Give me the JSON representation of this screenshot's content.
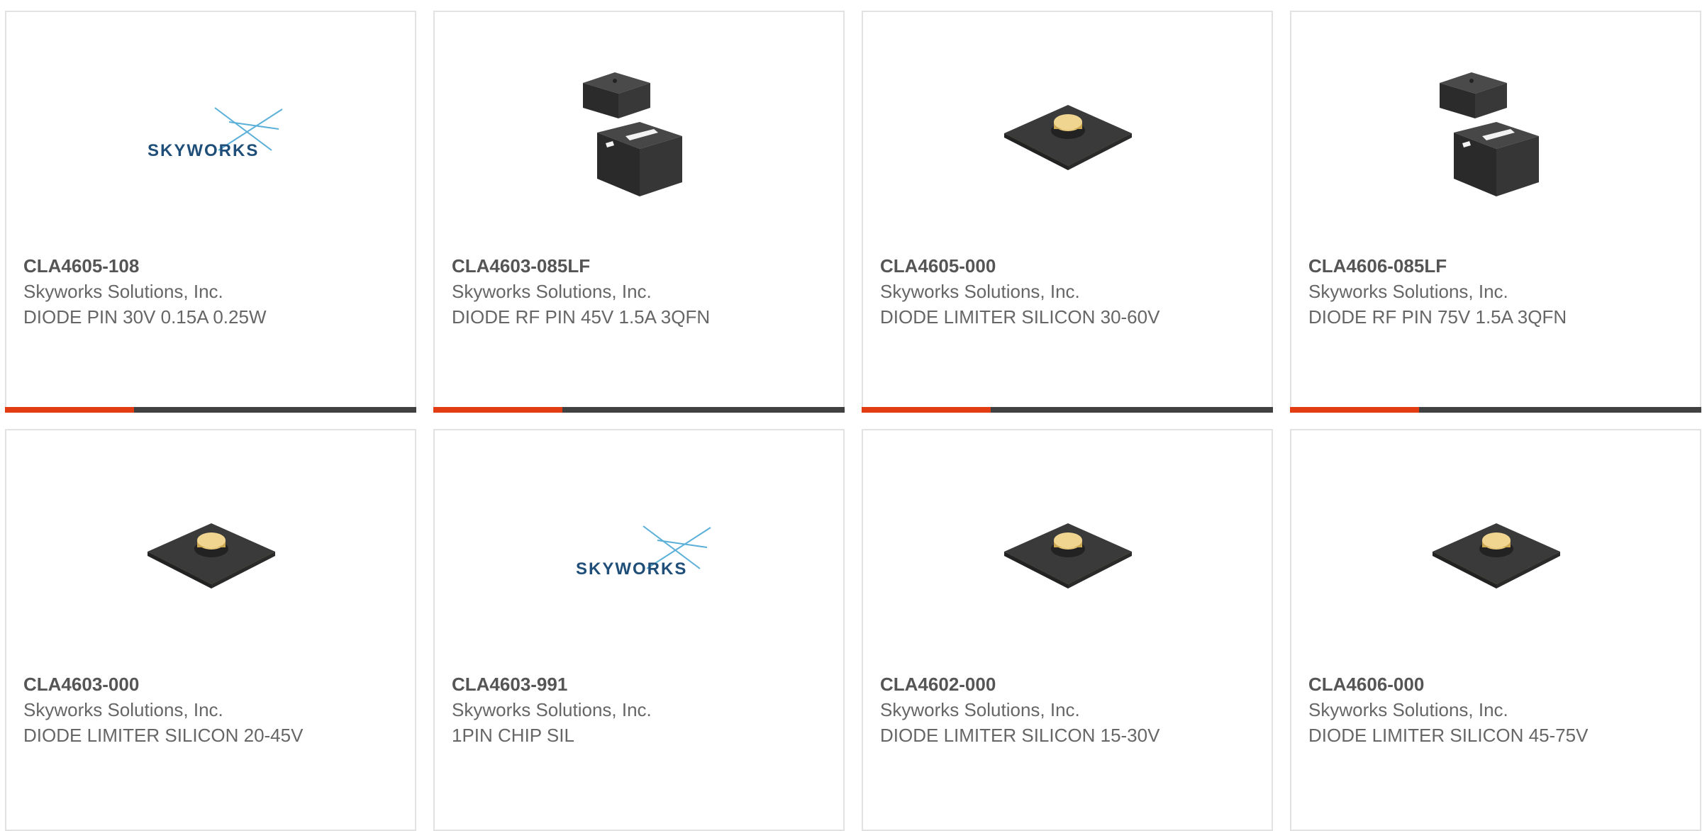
{
  "products": [
    {
      "part": "CLA4605-108",
      "manufacturer": "Skyworks Solutions, Inc.",
      "description": "DIODE PIN 30V 0.15A 0.25W",
      "image": "skyworks-logo"
    },
    {
      "part": "CLA4603-085LF",
      "manufacturer": "Skyworks Solutions, Inc.",
      "description": "DIODE RF PIN 45V 1.5A 3QFN",
      "image": "qfn-package-icon"
    },
    {
      "part": "CLA4605-000",
      "manufacturer": "Skyworks Solutions, Inc.",
      "description": "DIODE LIMITER SILICON 30-60V",
      "image": "chip-diode-icon"
    },
    {
      "part": "CLA4606-085LF",
      "manufacturer": "Skyworks Solutions, Inc.",
      "description": "DIODE RF PIN 75V 1.5A 3QFN",
      "image": "qfn-package-icon"
    },
    {
      "part": "CLA4603-000",
      "manufacturer": "Skyworks Solutions, Inc.",
      "description": "DIODE LIMITER SILICON 20-45V",
      "image": "chip-diode-icon"
    },
    {
      "part": "CLA4603-991",
      "manufacturer": "Skyworks Solutions, Inc.",
      "description": "1PIN CHIP SIL",
      "image": "skyworks-logo"
    },
    {
      "part": "CLA4602-000",
      "manufacturer": "Skyworks Solutions, Inc.",
      "description": "DIODE LIMITER SILICON 15-30V",
      "image": "chip-diode-icon"
    },
    {
      "part": "CLA4606-000",
      "manufacturer": "Skyworks Solutions, Inc.",
      "description": "DIODE LIMITER SILICON 45-75V",
      "image": "chip-diode-icon"
    }
  ],
  "logo_text": "SKYWORKS",
  "colors": {
    "accent": "#e23c12",
    "bar": "#414141",
    "border": "#e2e2e2",
    "logo_blue": "#1f4e79",
    "part_text": "#555555",
    "body_text": "#666666",
    "chip_dark": "#333333",
    "chip_gold": "#d8b86a"
  }
}
